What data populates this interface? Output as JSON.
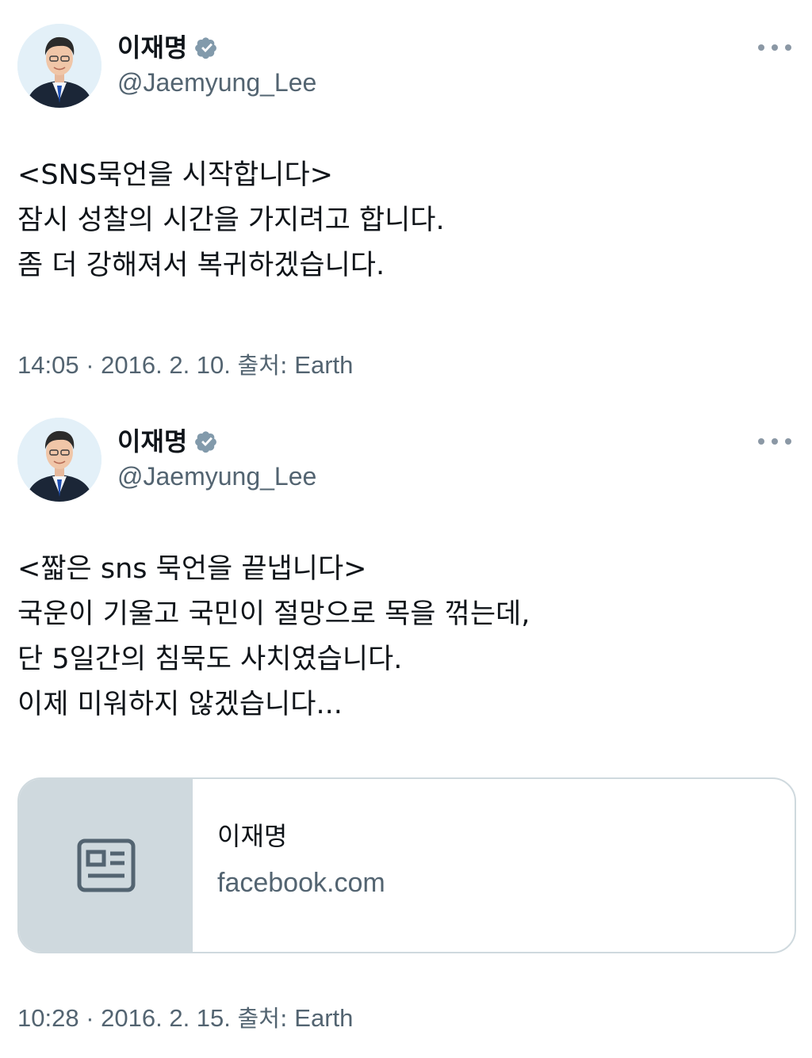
{
  "tweets": [
    {
      "author": {
        "display_name": "이재명",
        "handle": "@Jaemyung_Lee",
        "verified_icon": "verified-badge-icon"
      },
      "more_icon": "more-horizontal-icon",
      "text_lines": [
        "<SNS묵언을 시작합니다>",
        "잠시 성찰의 시간을 가지려고 합니다.",
        "좀 더 강해져서 복귀하겠습니다."
      ],
      "time": "14:05",
      "date": "2016. 2. 10.",
      "source_label": "출처:",
      "source": "Earth"
    },
    {
      "author": {
        "display_name": "이재명",
        "handle": "@Jaemyung_Lee",
        "verified_icon": "verified-badge-icon"
      },
      "more_icon": "more-horizontal-icon",
      "text_lines": [
        "<짧은 sns 묵언을 끝냅니다>",
        "국운이 기울고 국민이 절망으로 목을 꺾는데,",
        "단 5일간의 침묵도 사치였습니다.",
        "이제 미워하지 않겠습니다..."
      ],
      "link_card": {
        "thumb_icon": "article-icon",
        "title": "이재명",
        "domain": "facebook.com"
      },
      "time": "10:28",
      "date": "2016. 2. 15.",
      "source_label": "출처:",
      "source": "Earth"
    }
  ],
  "colors": {
    "text_primary": "#0f1419",
    "text_secondary": "#536471",
    "verified_badge": "#829aab",
    "card_border": "#cfd9de",
    "card_thumb_bg": "#cfd9de"
  }
}
